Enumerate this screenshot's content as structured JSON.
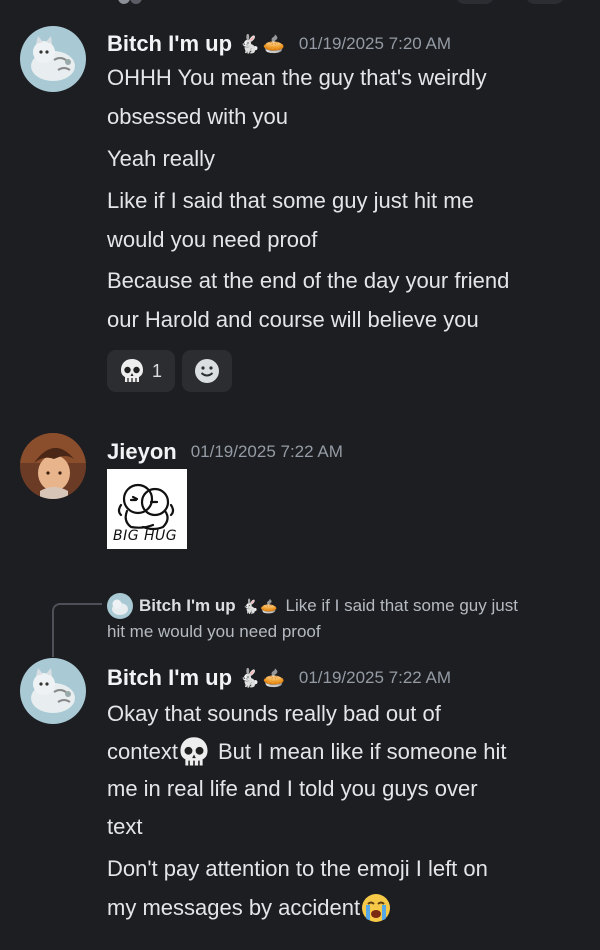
{
  "messages": [
    {
      "author": "Bitch I'm up",
      "decorations": [
        "rabbit-emoji",
        "pie-emoji"
      ],
      "timestamp": "01/19/2025 7:20 AM",
      "lines": [
        "OHHH You mean the guy that's weirdly",
        "obsessed with you",
        "Yeah really",
        "Like if I said that some guy just hit me",
        "would  you need proof",
        "Because at the end of the day your friend",
        "our Harold and course will believe you"
      ],
      "reactions": [
        {
          "icon": "skull-emoji",
          "count": "1"
        },
        {
          "icon": "add-reaction-icon",
          "count": ""
        }
      ]
    },
    {
      "author": "Jieyon",
      "timestamp": "01/19/2025 7:22 AM",
      "sticker_text": "BIG HUG"
    },
    {
      "reply_to": {
        "author": "Bitch I'm up",
        "text_line1": "Like if I said that some guy just",
        "text_line2": "hit me would  you need proof"
      },
      "author": "Bitch I'm up",
      "decorations": [
        "rabbit-emoji",
        "pie-emoji"
      ],
      "timestamp": "01/19/2025 7:22 AM",
      "lines": [
        "Okay that sounds really bad out of",
        "context",
        "But I mean like if someone hit",
        "me in real life and I told you guys over",
        "text",
        "Don't pay attention to the  emoji I left on",
        "my messages by accident"
      ],
      "inline_emojis": [
        "skull-emoji",
        "loudly-crying-face-emoji"
      ]
    }
  ],
  "colors": {
    "background": "#1d1e22",
    "text": "#e3e5e8",
    "username": "#f2f3f5",
    "timestamp": "#949ba4",
    "reaction_bg": "#2b2d31"
  }
}
